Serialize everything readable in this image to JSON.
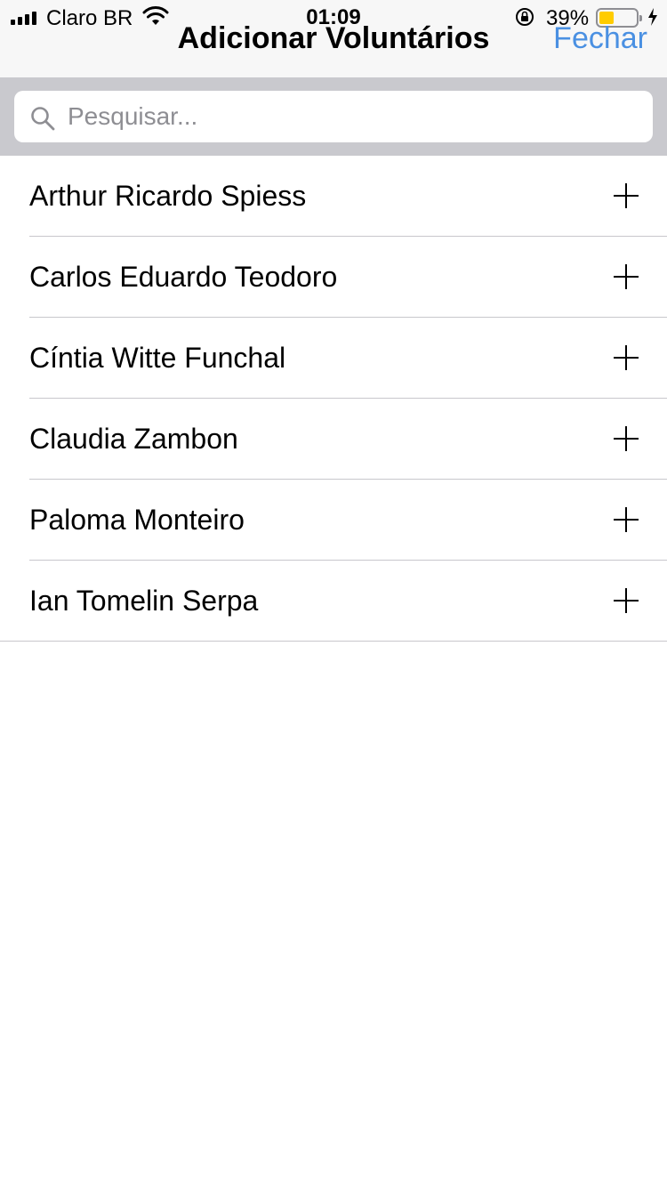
{
  "status_bar": {
    "carrier": "Claro BR",
    "time": "01:09",
    "battery_percent": "39%",
    "battery_level": 0.39,
    "icons": [
      "signal-icon",
      "wifi-icon",
      "orientation-lock-icon",
      "battery-icon",
      "charging-bolt-icon"
    ]
  },
  "nav": {
    "title": "Adicionar Voluntários",
    "close_label": "Fechar",
    "accent_color": "#4a90e2"
  },
  "search": {
    "placeholder": "Pesquisar...",
    "value": ""
  },
  "volunteers": [
    {
      "name": "Arthur Ricardo Spiess",
      "action_icon": "plus-icon"
    },
    {
      "name": "Carlos Eduardo Teodoro",
      "action_icon": "plus-icon"
    },
    {
      "name": "Cíntia Witte Funchal",
      "action_icon": "plus-icon"
    },
    {
      "name": "Claudia Zambon",
      "action_icon": "plus-icon"
    },
    {
      "name": "Paloma Monteiro",
      "action_icon": "plus-icon"
    },
    {
      "name": "Ian Tomelin Serpa",
      "action_icon": "plus-icon"
    }
  ]
}
